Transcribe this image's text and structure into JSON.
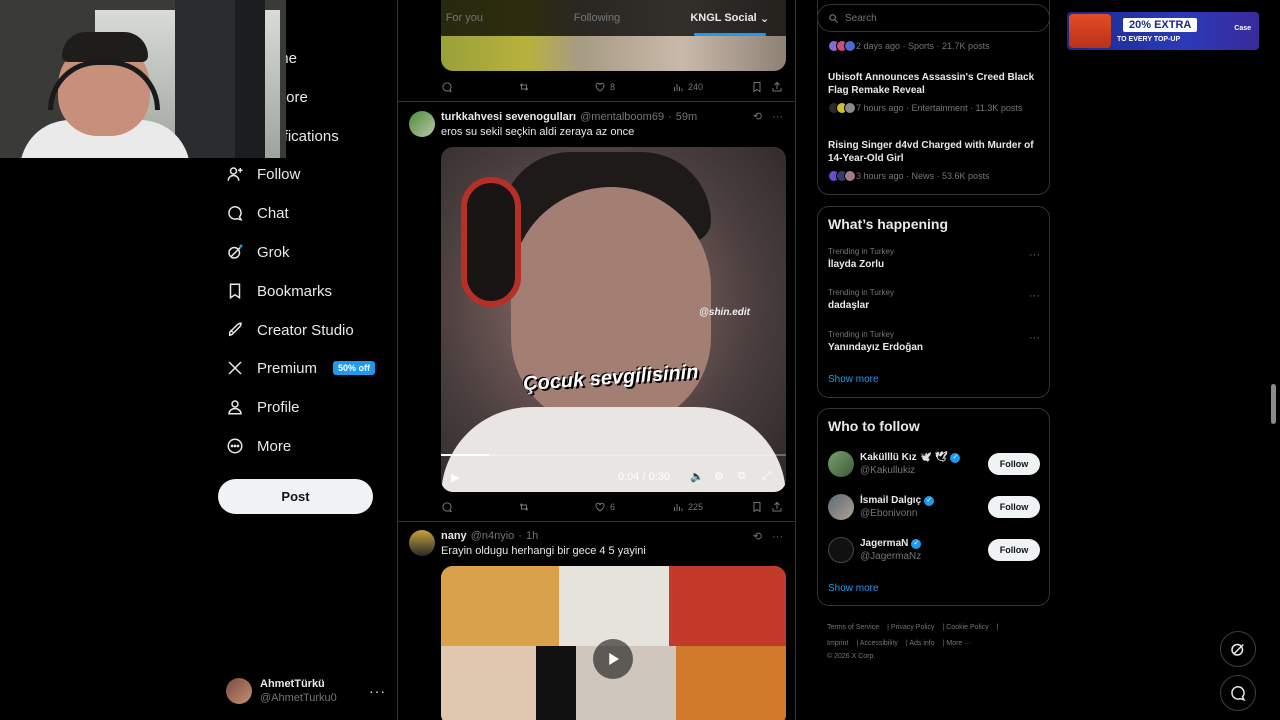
{
  "nav": {
    "items": [
      {
        "label": "Home",
        "icon": "home-icon"
      },
      {
        "label": "Explore",
        "icon": "search-icon"
      },
      {
        "label": "Notifications",
        "icon": "bell-icon"
      },
      {
        "label": "Follow",
        "icon": "follow-icon"
      },
      {
        "label": "Chat",
        "icon": "chat-icon"
      },
      {
        "label": "Grok",
        "icon": "grok-icon"
      },
      {
        "label": "Bookmarks",
        "icon": "bookmark-icon"
      },
      {
        "label": "Creator Studio",
        "icon": "rocket-icon"
      },
      {
        "label": "Premium",
        "icon": "x-logo-icon"
      },
      {
        "label": "Profile",
        "icon": "person-icon"
      },
      {
        "label": "More",
        "icon": "more-circle-icon"
      }
    ],
    "premium_badge": "50% off",
    "post_label": "Post"
  },
  "account": {
    "name": "AhmetTürkü",
    "handle": "@AhmetTurku0"
  },
  "tabs": [
    {
      "label": "For you"
    },
    {
      "label": "Following"
    },
    {
      "label": "KNGL Social"
    }
  ],
  "feed": {
    "prev_actions": {
      "replies": "",
      "reposts": "",
      "likes": "8",
      "views": "240"
    },
    "tweet1": {
      "name": "turkkahvesi sevenogulları",
      "handle": "@mentalboom69",
      "time": "59m",
      "text": "eros su sekil seçkin aldi zeraya az once",
      "video": {
        "watermark": "@shin.edit",
        "caption": "Çocuk sevgilisinin",
        "time": "0:04 / 0:30",
        "progress": 0.14
      },
      "actions": {
        "likes": "6",
        "views": "225"
      }
    },
    "tweet2": {
      "name": "nany",
      "handle": "@n4nyio",
      "time": "1h",
      "text": "Erayin oldugu herhangi bir gece 4 5 yayini"
    }
  },
  "search": {
    "placeholder": "Search"
  },
  "news": [
    {
      "title": "",
      "meta": "2 days ago · Sports · 21.7K posts"
    },
    {
      "title": "Ubisoft Announces Assassin's Creed Black Flag Remake Reveal",
      "meta": "7 hours ago · Entertainment · 11.3K posts"
    },
    {
      "title": "Rising Singer d4vd Charged with Murder of 14-Year-Old Girl",
      "meta": "3 hours ago · News · 53.6K posts"
    }
  ],
  "happening": {
    "title": "What’s happening",
    "trends": [
      {
        "category": "Trending in Turkey",
        "name": "İlayda Zorlu"
      },
      {
        "category": "Trending in Turkey",
        "name": "dadaşlar"
      },
      {
        "category": "Trending in Turkey",
        "name": "Yanındayız Erdoğan"
      }
    ],
    "show_more": "Show more"
  },
  "who_to_follow": {
    "title": "Who to follow",
    "users": [
      {
        "name": "Kakülllü Kız 🕊️ 🕊",
        "handle": "@Kakullukiz"
      },
      {
        "name": "İsmail Dalgıç",
        "handle": "@Ebonivonn"
      },
      {
        "name": "JagermaN",
        "handle": "@JagermaNz"
      }
    ],
    "follow_label": "Follow",
    "show_more": "Show more"
  },
  "footer": {
    "links": [
      "Terms of Service",
      "Privacy Policy",
      "Cookie Policy",
      "Imprint",
      "Accessibility",
      "Ads info",
      "More ···"
    ],
    "copyright": "© 2026 X Corp."
  },
  "ad": {
    "headline": "20% EXTRA",
    "sub": "TO EVERY TOP-UP",
    "brand": "Case"
  },
  "colors": {
    "accent": "#1d9bf0",
    "background": "#000000",
    "border": "#2f3336",
    "muted": "#71767b"
  }
}
